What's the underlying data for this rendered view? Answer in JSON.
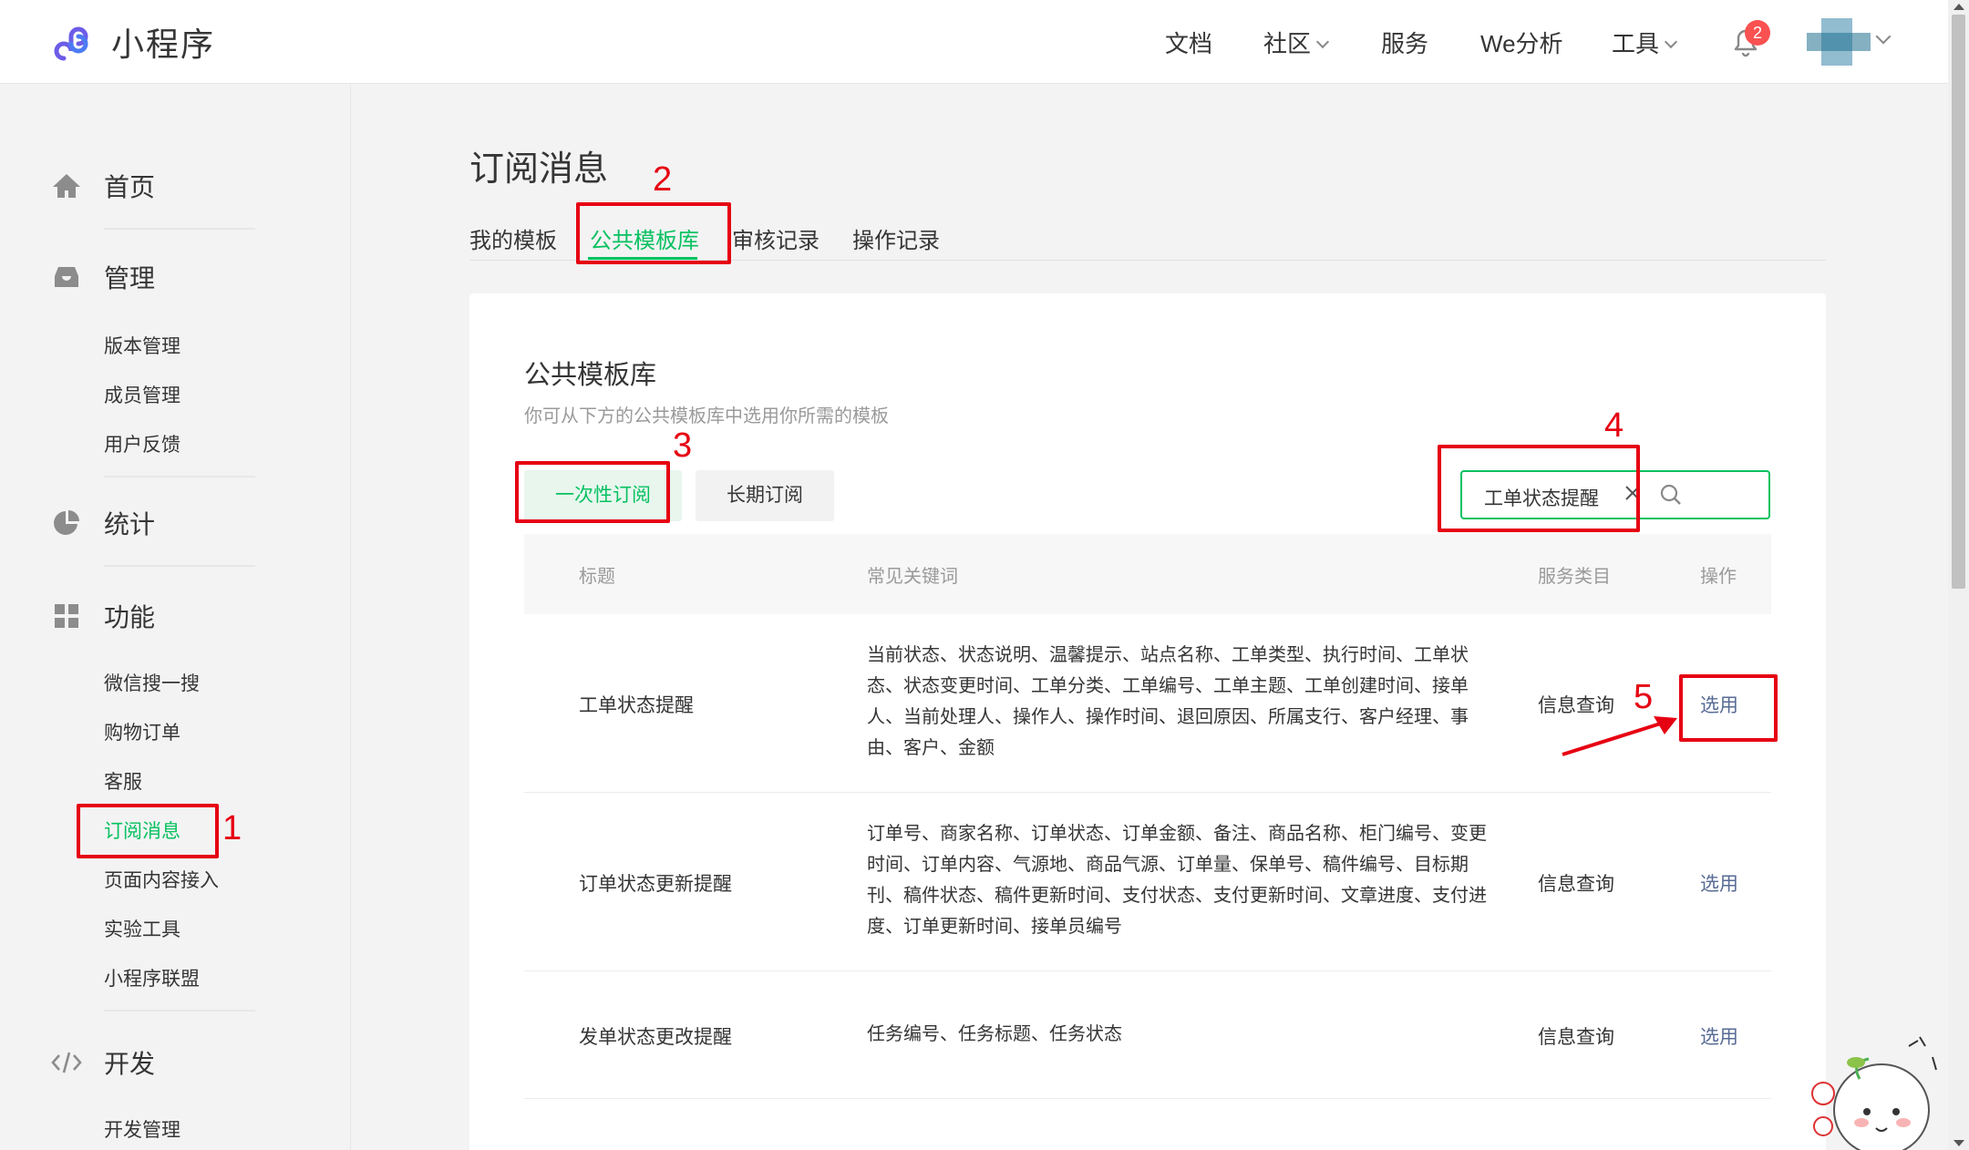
{
  "header": {
    "logo_text": "小程序",
    "nav": [
      {
        "label": "文档",
        "has_dropdown": false
      },
      {
        "label": "社区",
        "has_dropdown": true
      },
      {
        "label": "服务",
        "has_dropdown": false
      },
      {
        "label": "We分析",
        "has_dropdown": false
      },
      {
        "label": "工具",
        "has_dropdown": true
      }
    ],
    "notification_count": "2"
  },
  "sidebar": {
    "sections": [
      {
        "label": "首页",
        "icon": "home-icon"
      },
      {
        "label": "管理",
        "icon": "inbox-icon",
        "items": [
          "版本管理",
          "成员管理",
          "用户反馈"
        ]
      },
      {
        "label": "统计",
        "icon": "pie-chart-icon"
      },
      {
        "label": "功能",
        "icon": "grid-icon",
        "items": [
          "微信搜一搜",
          "购物订单",
          "客服",
          "订阅消息",
          "页面内容接入",
          "实验工具",
          "小程序联盟"
        ]
      },
      {
        "label": "开发",
        "icon": "code-icon",
        "items": [
          "开发管理"
        ]
      }
    ],
    "active_item": "订阅消息"
  },
  "main": {
    "title": "订阅消息",
    "tabs": [
      "我的模板",
      "公共模板库",
      "审核记录",
      "操作记录"
    ],
    "active_tab": "公共模板库",
    "card": {
      "title": "公共模板库",
      "description": "你可从下方的公共模板库中选用你所需的模板",
      "subtabs": [
        "一次性订阅",
        "长期订阅"
      ],
      "active_subtab": "一次性订阅",
      "search": {
        "value": "工单状态提醒"
      },
      "table": {
        "columns": [
          "标题",
          "常见关键词",
          "服务类目",
          "操作"
        ],
        "rows": [
          {
            "title": "工单状态提醒",
            "keywords": [
              "当前状态、状态说明、温馨提示、站点名称、工单类型、执行时间、工单状",
              "态、状态变更时间、工单分类、工单编号、工单主题、工单创建时间、接单",
              "人、当前处理人、操作人、操作时间、退回原因、所属支行、客户经理、事",
              "由、客户、金额"
            ],
            "category": "信息查询",
            "action": "选用"
          },
          {
            "title": "订单状态更新提醒",
            "keywords": [
              "订单号、商家名称、订单状态、订单金额、备注、商品名称、柜门编号、变更",
              "时间、订单内容、气源地、商品气源、订单量、保单号、稿件编号、目标期",
              "刊、稿件状态、稿件更新时间、支付状态、支付更新时间、文章进度、支付进",
              "度、订单更新时间、接单员编号"
            ],
            "category": "信息查询",
            "action": "选用"
          },
          {
            "title": "发单状态更改提醒",
            "keywords": [
              "任务编号、任务标题、任务状态"
            ],
            "category": "信息查询",
            "action": "选用"
          }
        ]
      }
    }
  },
  "annotations": [
    "1",
    "2",
    "3",
    "4",
    "5"
  ],
  "colors": {
    "accent": "#07c160",
    "link": "#576b95",
    "annotation": "#e60012",
    "badge": "#fa5151"
  }
}
